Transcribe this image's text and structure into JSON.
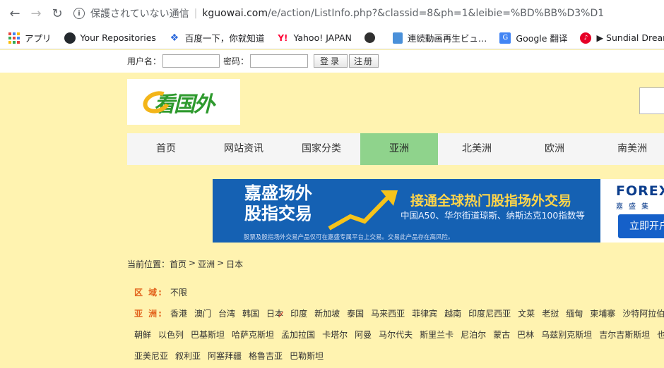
{
  "browser": {
    "security_text": "保護されていない通信",
    "url_host": "kguowai.com",
    "url_rest": "/e/action/ListInfo.php?&classid=8&ph=1&leibie=%BD%BB%D3%D1"
  },
  "bookmarks": [
    {
      "label": "アプリ",
      "icon": "apps-icon"
    },
    {
      "label": "Your Repositories",
      "icon": "github-icon"
    },
    {
      "label": "百度一下，你就知道",
      "icon": "paw-icon"
    },
    {
      "label": "Yahoo! JAPAN",
      "icon": "yahoo-icon"
    },
    {
      "label": "",
      "icon": "globe-icon"
    },
    {
      "label": "連続動画再生ビュ…",
      "icon": "document-icon"
    },
    {
      "label": "Google 翻译",
      "icon": "google-translate-icon"
    },
    {
      "label": "▶ Sundial Dreams",
      "icon": "music-icon"
    }
  ],
  "login": {
    "username_label": "用户名：",
    "password_label": "密码：",
    "login_button": "登录",
    "register_button": "注册"
  },
  "logo": {
    "text": "看国外"
  },
  "nav": {
    "items": [
      "首页",
      "网站资讯",
      "国家分类",
      "亚洲",
      "北美洲",
      "欧洲",
      "南美洲"
    ],
    "active": "亚洲"
  },
  "banner": {
    "title_line1": "嘉盛场外",
    "title_line2": "股指交易",
    "headline": "接通全球热门股指场外交易",
    "subline": "中国A50、华尔街道琼斯、纳斯达克100指数等",
    "disclaimer": "股票及股指场外交易产品仅可在嘉盛专属平台上交易。交易此产品存在高风险。",
    "brand": "FOREX",
    "brand_sub": "嘉盛集",
    "cta": "立即开户"
  },
  "breadcrumb": {
    "prefix": "当前位置：",
    "items": [
      "首页",
      "亚洲",
      "日本"
    ]
  },
  "filters": {
    "region_label": "区 域:",
    "region_value": "不限",
    "country_label": "亚 洲:",
    "countries_row1": [
      "香港",
      "澳门",
      "台湾",
      "韩国",
      "日本",
      "印度",
      "新加坡",
      "泰国",
      "马来西亚",
      "菲律宾",
      "越南",
      "印度尼西亚",
      "文莱",
      "老挝",
      "缅甸",
      "柬埔寨",
      "沙特阿拉伯"
    ],
    "countries_row2": [
      "朝鲜",
      "以色列",
      "巴基斯坦",
      "哈萨克斯坦",
      "孟加拉国",
      "卡塔尔",
      "阿曼",
      "马尔代夫",
      "斯里兰卡",
      "尼泊尔",
      "蒙古",
      "巴林",
      "乌兹别克斯坦",
      "吉尔吉斯斯坦",
      "也门"
    ],
    "countries_row3": [
      "亚美尼亚",
      "叙利亚",
      "阿塞拜疆",
      "格鲁吉亚",
      "巴勒斯坦"
    ],
    "selected": "日本"
  }
}
